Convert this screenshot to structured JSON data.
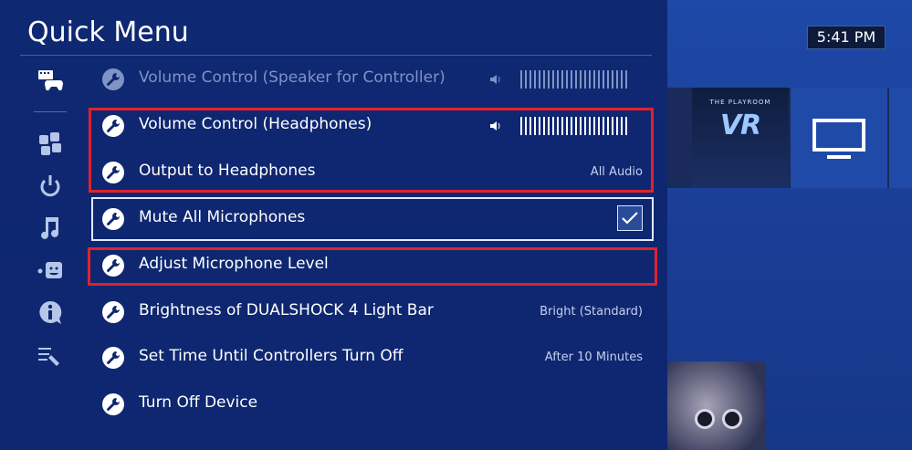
{
  "quick_menu": {
    "title": "Quick Menu",
    "sidebar": [
      {
        "id": "controller-keyboard",
        "icon": "controller-keyboard-icon",
        "active": true
      },
      {
        "id": "games",
        "icon": "puzzle-icon",
        "active": false
      },
      {
        "id": "power",
        "icon": "power-icon",
        "active": false
      },
      {
        "id": "music",
        "icon": "music-note-icon",
        "active": false
      },
      {
        "id": "party",
        "icon": "party-icon",
        "active": false
      },
      {
        "id": "info",
        "icon": "info-icon",
        "active": false
      },
      {
        "id": "customize",
        "icon": "customize-list-icon",
        "active": false
      }
    ],
    "items": [
      {
        "label": "Volume Control (Speaker for Controller)",
        "value": "",
        "state": "disabled",
        "volume_level": 1.0
      },
      {
        "label": "Volume Control (Headphones)",
        "value": "",
        "state": "normal",
        "volume_level": 1.0
      },
      {
        "label": "Output to Headphones",
        "value": "All Audio",
        "state": "normal"
      },
      {
        "label": "Mute All Microphones",
        "value": "",
        "state": "focused",
        "checked": true
      },
      {
        "label": "Adjust Microphone Level",
        "value": "",
        "state": "normal"
      },
      {
        "label": "Brightness of DUALSHOCK 4 Light Bar",
        "value": "Bright (Standard)",
        "state": "normal"
      },
      {
        "label": "Set Time Until Controllers Turn Off",
        "value": "After 10 Minutes",
        "state": "normal"
      },
      {
        "label": "Turn Off Device",
        "value": "",
        "state": "normal"
      }
    ]
  },
  "home_screen": {
    "clock": "5:41 PM",
    "tiles": [
      {
        "small": "THE PLAYROOM",
        "big": "VR"
      },
      {
        "icon": "tv-icon"
      }
    ]
  },
  "colors": {
    "panel": "#0e266e",
    "highlight_red": "#e0222e",
    "focus_border": "#e4eaff"
  }
}
